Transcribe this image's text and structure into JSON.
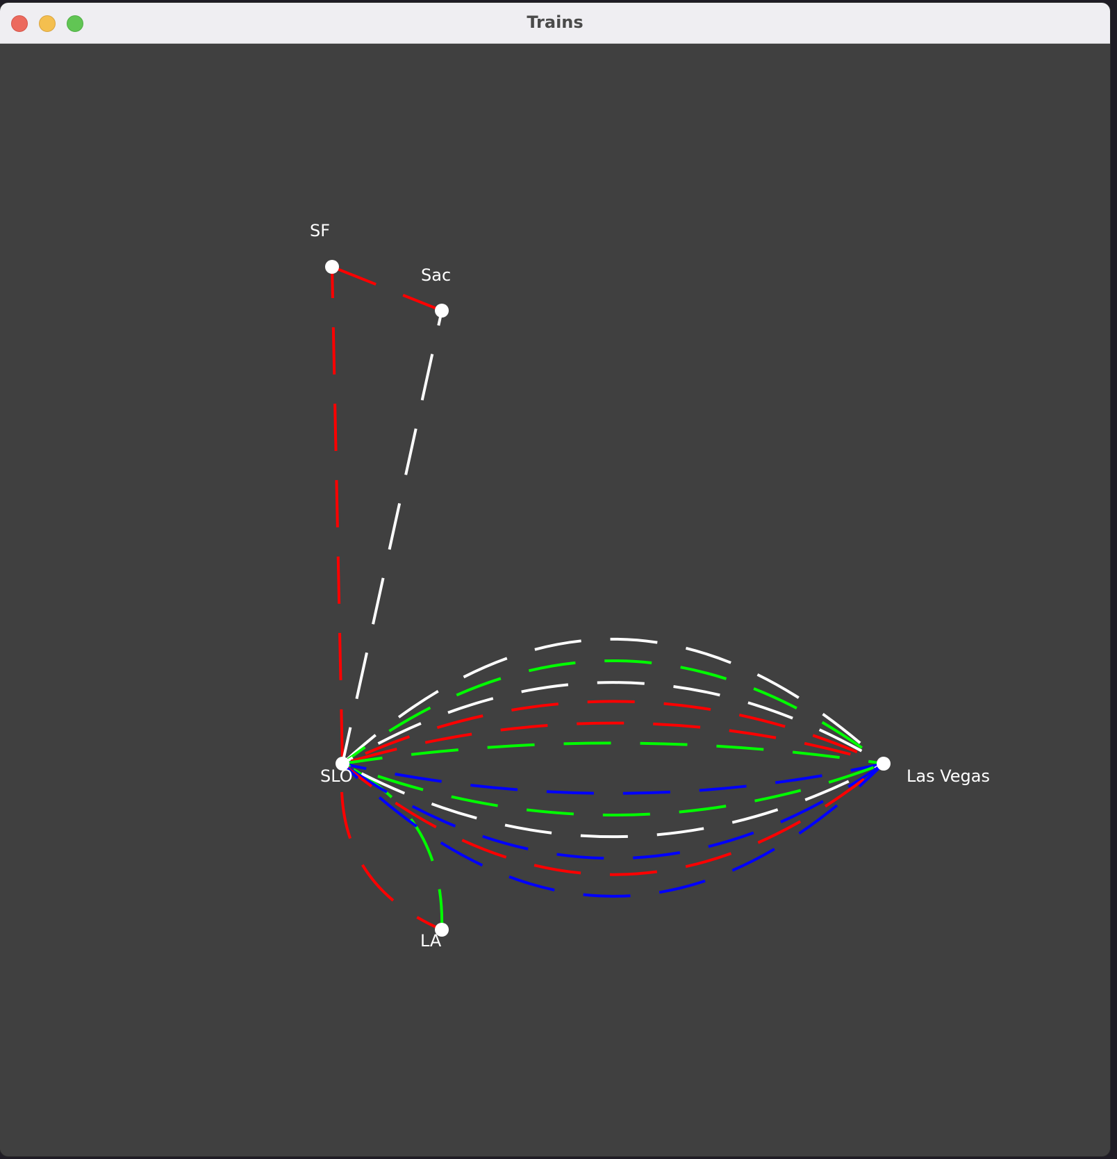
{
  "window": {
    "title": "Trains"
  },
  "icons": {
    "close": "close-traffic-light-icon",
    "minimize": "minimize-traffic-light-icon",
    "zoom": "zoom-traffic-light-icon"
  },
  "colors": {
    "background": "#404040",
    "node": "#ffffff",
    "red": "#ff0000",
    "green": "#00ff00",
    "blue": "#0000ff",
    "white": "#ffffff"
  },
  "stations": [
    {
      "id": "SF",
      "label": "SF"
    },
    {
      "id": "Sac",
      "label": "Sac"
    },
    {
      "id": "SLO",
      "label": "SLO"
    },
    {
      "id": "LA",
      "label": "LA"
    },
    {
      "id": "LV",
      "label": "Las Vegas"
    }
  ],
  "routes": [
    {
      "from": "SF",
      "to": "Sac",
      "color": "red",
      "bend": 0
    },
    {
      "from": "SF",
      "to": "SLO",
      "color": "red",
      "bend": 0
    },
    {
      "from": "Sac",
      "to": "SLO",
      "color": "white",
      "bend": 0
    },
    {
      "from": "SLO",
      "to": "LA",
      "color": "red",
      "bend": -0.18
    },
    {
      "from": "SLO",
      "to": "LA",
      "color": "green",
      "bend": 0.16
    },
    {
      "from": "SLO",
      "to": "LV",
      "color": "white",
      "bend": 0.23
    },
    {
      "from": "SLO",
      "to": "LV",
      "color": "green",
      "bend": 0.19
    },
    {
      "from": "SLO",
      "to": "LV",
      "color": "white",
      "bend": 0.15
    },
    {
      "from": "SLO",
      "to": "LV",
      "color": "red",
      "bend": 0.115
    },
    {
      "from": "SLO",
      "to": "LV",
      "color": "red",
      "bend": 0.075
    },
    {
      "from": "SLO",
      "to": "LV",
      "color": "green",
      "bend": 0.038
    },
    {
      "from": "SLO",
      "to": "LV",
      "color": "blue",
      "bend": -0.055
    },
    {
      "from": "SLO",
      "to": "LV",
      "color": "green",
      "bend": -0.095
    },
    {
      "from": "SLO",
      "to": "LV",
      "color": "white",
      "bend": -0.135
    },
    {
      "from": "SLO",
      "to": "LV",
      "color": "blue",
      "bend": -0.175
    },
    {
      "from": "SLO",
      "to": "LV",
      "color": "red",
      "bend": -0.205
    },
    {
      "from": "SLO",
      "to": "LV",
      "color": "blue",
      "bend": -0.245
    }
  ]
}
